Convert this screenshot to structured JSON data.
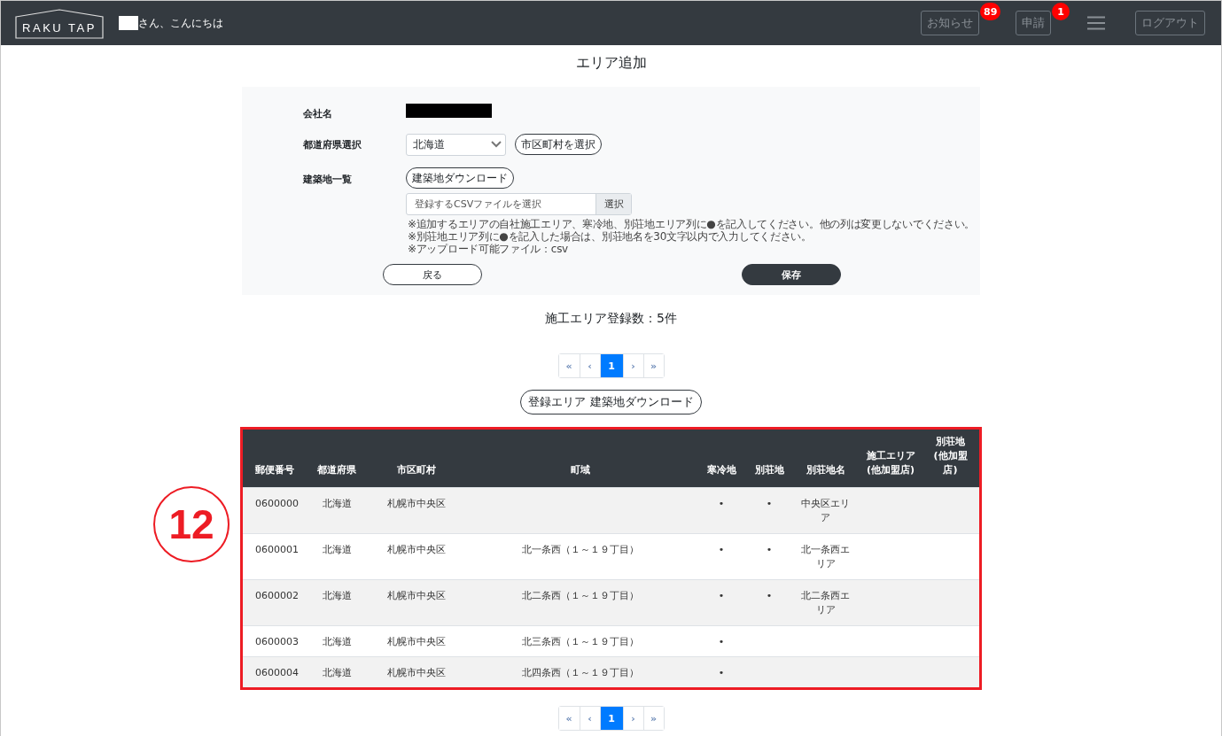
{
  "header": {
    "logo": "RAKU TAP",
    "greeting": "さん、こんにちは",
    "nav": [
      {
        "label": "お知らせ",
        "badge": "89"
      },
      {
        "label": "申請",
        "badge": "1"
      }
    ],
    "logout": "ログアウト"
  },
  "page_title": "エリア追加",
  "form": {
    "company_label": "会社名",
    "prefecture_label": "都道府県選択",
    "prefecture_value": "北海道",
    "city_button": "市区町村を選択",
    "sites_label": "建築地一覧",
    "sites_button": "建築地ダウンロード",
    "file_placeholder": "登録するCSVファイルを選択",
    "file_button": "選択",
    "notes": [
      "※追加するエリアの自社施工エリア、寒冷地、別荘地エリア列に●を記入してください。他の列は変更しないでください。",
      "※別荘地エリア列に●を記入した場合は、別荘地名を30文字以内で入力してください。",
      "※アップロード可能ファイル：csv"
    ],
    "back_button": "戻る",
    "save_button": "保存"
  },
  "count": "施工エリア登録数：5件",
  "pagination": [
    {
      "label": "«",
      "selected": false
    },
    {
      "label": "‹",
      "selected": false
    },
    {
      "label": "1",
      "selected": true
    },
    {
      "label": "›",
      "selected": false
    },
    {
      "label": "»",
      "selected": false
    }
  ],
  "area_download_button": "登録エリア 建築地ダウンロード",
  "table": {
    "columns": [
      "郵便番号",
      "都道府県",
      "市区町村",
      "町域",
      "寒冷地",
      "別荘地",
      "別荘地名",
      "施工エリア\n(他加盟店)",
      "別荘地\n(他加盟店)"
    ],
    "rows": [
      {
        "cells": [
          "0600000",
          "北海道",
          "札幌市中央区",
          null,
          "•",
          "•",
          "中央区エリア",
          null,
          null
        ]
      },
      {
        "cells": [
          "0600001",
          "北海道",
          "札幌市中央区",
          "北一条西（１～１９丁目）",
          "•",
          "•",
          "北一条西エリア",
          null,
          null
        ]
      },
      {
        "cells": [
          "0600002",
          "北海道",
          "札幌市中央区",
          "北二条西（１～１９丁目）",
          "•",
          "•",
          "北二条西エリア",
          null,
          null
        ]
      },
      {
        "cells": [
          "0600003",
          "北海道",
          "札幌市中央区",
          "北三条西（１～１９丁目）",
          "•",
          null,
          null,
          null,
          null
        ]
      },
      {
        "cells": [
          "0600004",
          "北海道",
          "札幌市中央区",
          "北四条西（１～１９丁目）",
          "•",
          null,
          null,
          null,
          null
        ]
      }
    ]
  },
  "annotation": {
    "label": "12"
  },
  "bottom_pagination": [
    {
      "label": "«",
      "selected": false
    },
    {
      "label": "‹",
      "selected": false
    },
    {
      "label": "1",
      "selected": true
    },
    {
      "label": "›",
      "selected": false
    },
    {
      "label": "»",
      "selected": false
    }
  ]
}
